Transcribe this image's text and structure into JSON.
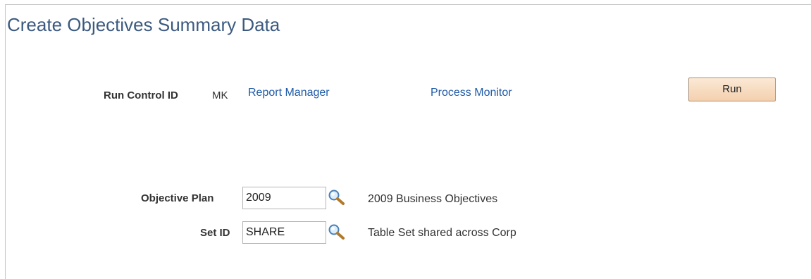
{
  "page": {
    "title": "Create Objectives Summary Data"
  },
  "run_control": {
    "label": "Run Control ID",
    "value": "MK",
    "report_manager_link": "Report Manager",
    "process_monitor_link": "Process Monitor",
    "run_button": "Run"
  },
  "form": {
    "objective_plan": {
      "label": "Objective Plan",
      "value": "2009",
      "lookup_icon": "magnifier-lookup-icon",
      "description": "2009 Business Objectives"
    },
    "set_id": {
      "label": "Set ID",
      "value": "SHARE",
      "lookup_icon": "magnifier-lookup-icon",
      "description": "Table Set shared across Corp"
    }
  },
  "colors": {
    "title": "#3c5a80",
    "link": "#1f5ba8",
    "button": "#f4d0ad"
  }
}
